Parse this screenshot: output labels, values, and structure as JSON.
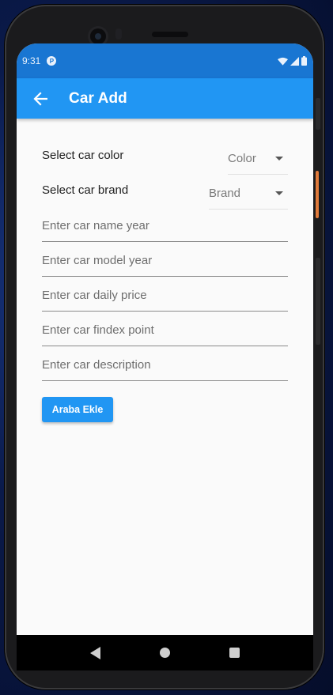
{
  "status_bar": {
    "time": "9:31",
    "notification_icon": "p-badge-icon",
    "indicators": [
      "wifi-icon",
      "signal-icon",
      "battery-icon"
    ]
  },
  "app_bar": {
    "back_icon": "arrow-left-icon",
    "title": "Car Add",
    "color": "#2196f3"
  },
  "form": {
    "color_select": {
      "label": "Select car color",
      "value": "Color"
    },
    "brand_select": {
      "label": "Select car brand",
      "value": "Brand"
    },
    "fields": {
      "name_year": {
        "placeholder": "Enter car name year",
        "value": ""
      },
      "model_year": {
        "placeholder": "Enter car model year",
        "value": ""
      },
      "daily_price": {
        "placeholder": "Enter car daily price",
        "value": ""
      },
      "findex_point": {
        "placeholder": "Enter car findex point",
        "value": ""
      },
      "description": {
        "placeholder": "Enter car description",
        "value": ""
      }
    },
    "submit_label": "Araba Ekle"
  },
  "nav_bar": {
    "buttons": [
      "back-triangle-icon",
      "home-circle-icon",
      "recents-square-icon"
    ]
  },
  "colors": {
    "status_bar": "#1976d2",
    "accent": "#2196f3",
    "background": "#fafafa"
  }
}
